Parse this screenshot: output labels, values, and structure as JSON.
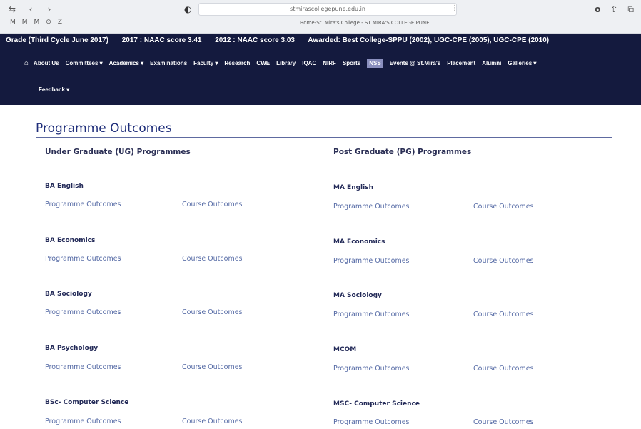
{
  "browser": {
    "address": "stmirascollegepune.edu.in",
    "page_title": "Home-St. Mira's College - ST MIRA'S COLLEGE PUNE"
  },
  "header": {
    "grade": "Grade (Third Cycle June 2017)",
    "naac_2017": "2017 : NAAC score 3.41",
    "naac_2012": "2012 : NAAC score 3.03",
    "awarded": "Awarded: Best College-SPPU (2002), UGC-CPE (2005), UGC-CPE (2010)"
  },
  "nav": {
    "items": [
      {
        "label": "About Us"
      },
      {
        "label": "Committees ▾"
      },
      {
        "label": "Academics ▾"
      },
      {
        "label": "Examinations"
      },
      {
        "label": "Faculty ▾"
      },
      {
        "label": "Research"
      },
      {
        "label": "CWE"
      },
      {
        "label": "Library"
      },
      {
        "label": "IQAC"
      },
      {
        "label": "NIRF"
      },
      {
        "label": "Sports"
      },
      {
        "label": "NSS"
      },
      {
        "label": "Events @ St.Mira's"
      },
      {
        "label": "Placement"
      },
      {
        "label": "Alumni"
      },
      {
        "label": "Galleries ▾"
      }
    ],
    "feedback": "Feedback ▾"
  },
  "main": {
    "title": "Programme Outcomes",
    "ug_heading": "Under Graduate (UG) Programmes",
    "pg_heading": "Post Graduate (PG) Programmes",
    "ug": [
      {
        "name": "BA English",
        "po": "Programme Outcomes",
        "co": "Course Outcomes"
      },
      {
        "name": "BA Economics",
        "po": "Programme Outcomes",
        "co": "Course Outcomes"
      },
      {
        "name": "BA Sociology",
        "po": "Programme Outcomes",
        "co": "Course Outcomes"
      },
      {
        "name": "BA Psychology",
        "po": "Programme Outcomes",
        "co": "Course Outcomes"
      },
      {
        "name": "BSc- Computer Science",
        "po": "Programme Outcomes",
        "co": "Course Outcomes"
      }
    ],
    "pg": [
      {
        "name": "MA English",
        "po": "Programme Outcomes",
        "co": "Course Outcomes"
      },
      {
        "name": "MA Economics",
        "po": "Programme Outcomes",
        "co": "Course Outcomes"
      },
      {
        "name": "MA Sociology",
        "po": "Programme Outcomes",
        "co": "Course Outcomes"
      },
      {
        "name": "MCOM",
        "po": "Programme Outcomes",
        "co": "Course Outcomes"
      },
      {
        "name": "MSC- Computer Science",
        "po": "Programme Outcomes",
        "co": "Course Outcomes"
      }
    ]
  },
  "colors": {
    "header_bg": "#141a3e",
    "title": "#1f2e7a",
    "link": "#556aa5"
  }
}
